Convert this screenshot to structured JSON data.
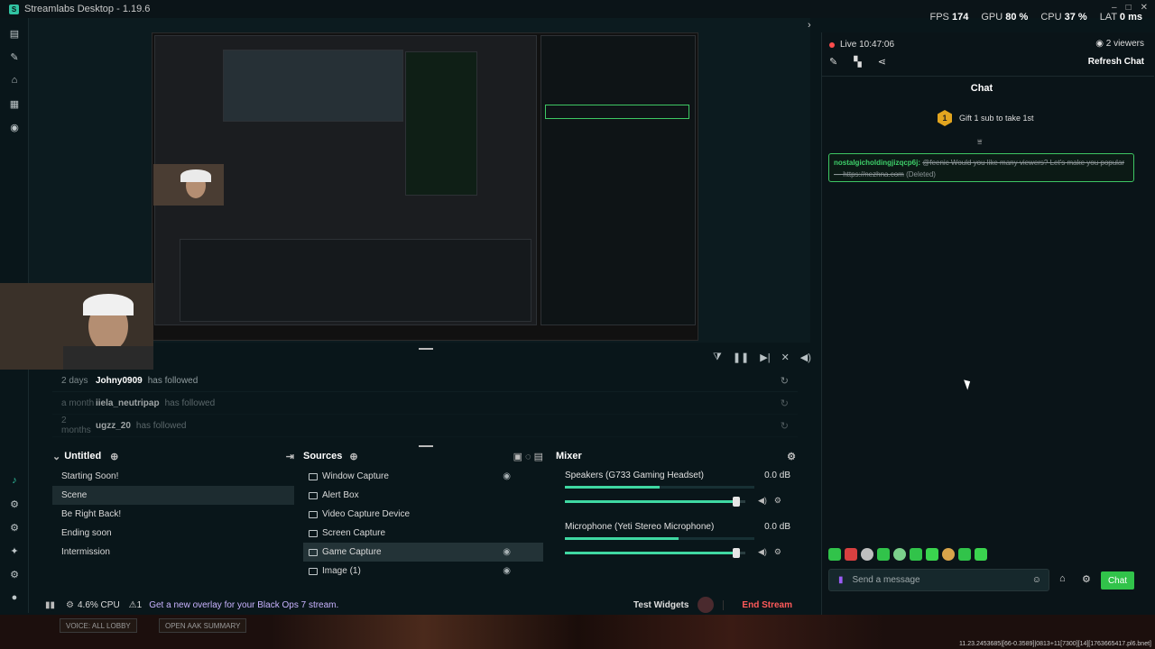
{
  "titlebar": {
    "title": "Streamlabs Desktop - 1.19.6"
  },
  "stats": {
    "fps_label": "FPS",
    "fps": "174",
    "gpu_label": "GPU",
    "gpu": "80 %",
    "cpu_label": "CPU",
    "cpu": "37 %",
    "lat_label": "LAT",
    "lat": "0 ms"
  },
  "events": [
    {
      "time": "2 days",
      "name": "Johny0909",
      "action": "has followed"
    },
    {
      "time": "a month",
      "name": "iiela_neutripap",
      "action": "has followed"
    },
    {
      "time": "2 months",
      "name": "ugzz_20",
      "action": "has followed"
    }
  ],
  "scenes": {
    "title": "Untitled",
    "items": [
      "Starting Soon!",
      "Scene",
      "Be Right Back!",
      "Ending soon",
      "Intermission"
    ],
    "selected": 1
  },
  "sources": {
    "title": "Sources",
    "items": [
      "Window Capture",
      "Alert Box",
      "Video Capture Device",
      "Screen Capture",
      "Game Capture",
      "Image (1)"
    ],
    "selected": 4
  },
  "mixer": {
    "title": "Mixer",
    "channels": [
      {
        "name": "Speakers (G733 Gaming Headset)",
        "db": "0.0 dB",
        "level": 0.5,
        "volume": 0.95
      },
      {
        "name": "Microphone (Yeti Stereo Microphone)",
        "db": "0.0 dB",
        "level": 0.6,
        "volume": 0.95
      }
    ]
  },
  "footer": {
    "cpu": "4.6% CPU",
    "promo": "Get a new overlay for your Black Ops 7 stream.",
    "test_widgets": "Test Widgets",
    "end_stream": "End Stream"
  },
  "chat": {
    "live": "Live 10:47:06",
    "viewers": "2 viewers",
    "refresh": "Refresh Chat",
    "title": "Chat",
    "gift_count": "1",
    "gift_text": "Gift 1 sub to take 1st",
    "msg_user": "nostalgicholdingjizqcp6j:",
    "msg_text": "@feenic Would you like many viewers? Let's make you popular — https://nezhna.com",
    "msg_deleted": "(Deleted)",
    "input_placeholder": "Send a message",
    "chat_button": "Chat"
  },
  "taskbar": {
    "btn1": "VOICE: ALL LOBBY",
    "btn2": "OPEN AAK SUMMARY",
    "info": "11.23.2453685|[66-0.3589]|0813+11[7300][14][1763665417.pl6.bnet]"
  },
  "colors": {
    "accent": "#31c3a2",
    "end": "#ff5a5a",
    "promo": "#c9b3ff",
    "chat_green": "#31c34a"
  }
}
